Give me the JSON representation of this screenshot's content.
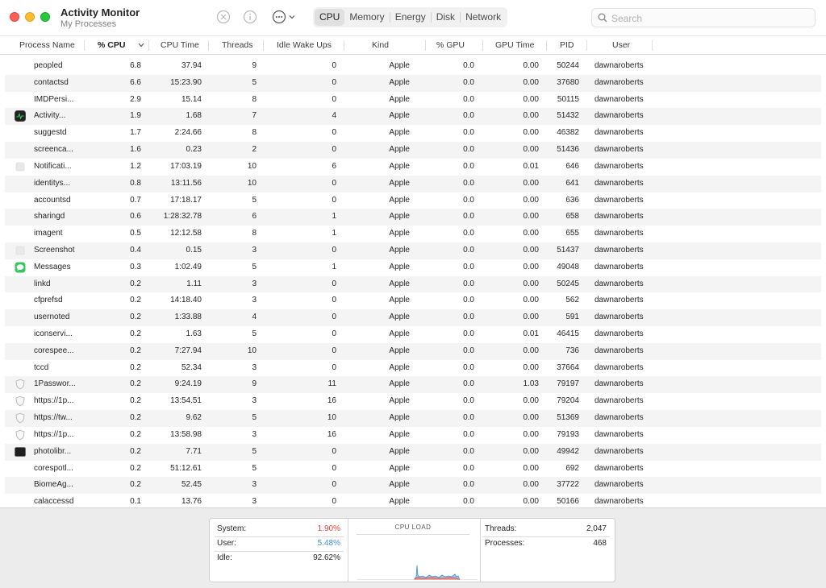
{
  "window": {
    "title": "Activity Monitor",
    "subtitle": "My Processes"
  },
  "toolbar": {
    "tabs": [
      {
        "label": "CPU",
        "active": true
      },
      {
        "label": "Memory",
        "active": false
      },
      {
        "label": "Energy",
        "active": false
      },
      {
        "label": "Disk",
        "active": false
      },
      {
        "label": "Network",
        "active": false
      }
    ],
    "buttons": {
      "stop": "stop-process-icon",
      "info": "info-icon",
      "more": "ellipsis-menu-icon"
    }
  },
  "search": {
    "placeholder": "Search",
    "value": ""
  },
  "table": {
    "columns": [
      "Process Name",
      "% CPU",
      "CPU Time",
      "Threads",
      "Idle Wake Ups",
      "Kind",
      "% GPU",
      "GPU Time",
      "PID",
      "User"
    ],
    "sorted_column": "% CPU",
    "rows": [
      {
        "name": "peopled",
        "cpu": "6.8",
        "cpu_time": "37.94",
        "threads": "9",
        "idle": "0",
        "kind": "Apple",
        "gpu": "0.0",
        "gpu_time": "0.00",
        "pid": "50244",
        "user": "dawnaroberts",
        "icon": ""
      },
      {
        "name": "contactsd",
        "cpu": "6.6",
        "cpu_time": "15:23.90",
        "threads": "5",
        "idle": "0",
        "kind": "Apple",
        "gpu": "0.0",
        "gpu_time": "0.00",
        "pid": "37680",
        "user": "dawnaroberts",
        "icon": ""
      },
      {
        "name": "IMDPersi...",
        "cpu": "2.9",
        "cpu_time": "15.14",
        "threads": "8",
        "idle": "0",
        "kind": "Apple",
        "gpu": "0.0",
        "gpu_time": "0.00",
        "pid": "50115",
        "user": "dawnaroberts",
        "icon": ""
      },
      {
        "name": "Activity...",
        "cpu": "1.9",
        "cpu_time": "1.68",
        "threads": "7",
        "idle": "4",
        "kind": "Apple",
        "gpu": "0.0",
        "gpu_time": "0.00",
        "pid": "51432",
        "user": "dawnaroberts",
        "icon": "activity-monitor"
      },
      {
        "name": "suggestd",
        "cpu": "1.7",
        "cpu_time": "2:24.66",
        "threads": "8",
        "idle": "0",
        "kind": "Apple",
        "gpu": "0.0",
        "gpu_time": "0.00",
        "pid": "46382",
        "user": "dawnaroberts",
        "icon": ""
      },
      {
        "name": "screenca...",
        "cpu": "1.6",
        "cpu_time": "0.23",
        "threads": "2",
        "idle": "0",
        "kind": "Apple",
        "gpu": "0.0",
        "gpu_time": "0.00",
        "pid": "51436",
        "user": "dawnaroberts",
        "icon": ""
      },
      {
        "name": "Notificati...",
        "cpu": "1.2",
        "cpu_time": "17:03.19",
        "threads": "10",
        "idle": "6",
        "kind": "Apple",
        "gpu": "0.0",
        "gpu_time": "0.01",
        "pid": "646",
        "user": "dawnaroberts",
        "icon": "blank"
      },
      {
        "name": "identitys...",
        "cpu": "0.8",
        "cpu_time": "13:11.56",
        "threads": "10",
        "idle": "0",
        "kind": "Apple",
        "gpu": "0.0",
        "gpu_time": "0.00",
        "pid": "641",
        "user": "dawnaroberts",
        "icon": ""
      },
      {
        "name": "accountsd",
        "cpu": "0.7",
        "cpu_time": "17:18.17",
        "threads": "5",
        "idle": "0",
        "kind": "Apple",
        "gpu": "0.0",
        "gpu_time": "0.00",
        "pid": "636",
        "user": "dawnaroberts",
        "icon": ""
      },
      {
        "name": "sharingd",
        "cpu": "0.6",
        "cpu_time": "1:28:32.78",
        "threads": "6",
        "idle": "1",
        "kind": "Apple",
        "gpu": "0.0",
        "gpu_time": "0.00",
        "pid": "658",
        "user": "dawnaroberts",
        "icon": ""
      },
      {
        "name": "imagent",
        "cpu": "0.5",
        "cpu_time": "12:12.58",
        "threads": "8",
        "idle": "1",
        "kind": "Apple",
        "gpu": "0.0",
        "gpu_time": "0.00",
        "pid": "655",
        "user": "dawnaroberts",
        "icon": ""
      },
      {
        "name": "Screenshot",
        "cpu": "0.4",
        "cpu_time": "0.15",
        "threads": "3",
        "idle": "0",
        "kind": "Apple",
        "gpu": "0.0",
        "gpu_time": "0.00",
        "pid": "51437",
        "user": "dawnaroberts",
        "icon": "blank"
      },
      {
        "name": "Messages",
        "cpu": "0.3",
        "cpu_time": "1:02.49",
        "threads": "5",
        "idle": "1",
        "kind": "Apple",
        "gpu": "0.0",
        "gpu_time": "0.00",
        "pid": "49048",
        "user": "dawnaroberts",
        "icon": "messages"
      },
      {
        "name": "linkd",
        "cpu": "0.2",
        "cpu_time": "1.11",
        "threads": "3",
        "idle": "0",
        "kind": "Apple",
        "gpu": "0.0",
        "gpu_time": "0.00",
        "pid": "50245",
        "user": "dawnaroberts",
        "icon": ""
      },
      {
        "name": "cfprefsd",
        "cpu": "0.2",
        "cpu_time": "14:18.40",
        "threads": "3",
        "idle": "0",
        "kind": "Apple",
        "gpu": "0.0",
        "gpu_time": "0.00",
        "pid": "562",
        "user": "dawnaroberts",
        "icon": ""
      },
      {
        "name": "usernoted",
        "cpu": "0.2",
        "cpu_time": "1:33.88",
        "threads": "4",
        "idle": "0",
        "kind": "Apple",
        "gpu": "0.0",
        "gpu_time": "0.00",
        "pid": "591",
        "user": "dawnaroberts",
        "icon": ""
      },
      {
        "name": "iconservi...",
        "cpu": "0.2",
        "cpu_time": "1.63",
        "threads": "5",
        "idle": "0",
        "kind": "Apple",
        "gpu": "0.0",
        "gpu_time": "0.01",
        "pid": "46415",
        "user": "dawnaroberts",
        "icon": ""
      },
      {
        "name": "corespee...",
        "cpu": "0.2",
        "cpu_time": "7:27.94",
        "threads": "10",
        "idle": "0",
        "kind": "Apple",
        "gpu": "0.0",
        "gpu_time": "0.00",
        "pid": "736",
        "user": "dawnaroberts",
        "icon": ""
      },
      {
        "name": "tccd",
        "cpu": "0.2",
        "cpu_time": "52.34",
        "threads": "3",
        "idle": "0",
        "kind": "Apple",
        "gpu": "0.0",
        "gpu_time": "0.00",
        "pid": "37664",
        "user": "dawnaroberts",
        "icon": ""
      },
      {
        "name": "1Passwor...",
        "cpu": "0.2",
        "cpu_time": "9:24.19",
        "threads": "9",
        "idle": "11",
        "kind": "Apple",
        "gpu": "0.0",
        "gpu_time": "1.03",
        "pid": "79197",
        "user": "dawnaroberts",
        "icon": "shield"
      },
      {
        "name": "https://1p...",
        "cpu": "0.2",
        "cpu_time": "13:54.51",
        "threads": "3",
        "idle": "16",
        "kind": "Apple",
        "gpu": "0.0",
        "gpu_time": "0.00",
        "pid": "79204",
        "user": "dawnaroberts",
        "icon": "shield"
      },
      {
        "name": "https://tw...",
        "cpu": "0.2",
        "cpu_time": "9.62",
        "threads": "5",
        "idle": "10",
        "kind": "Apple",
        "gpu": "0.0",
        "gpu_time": "0.00",
        "pid": "51369",
        "user": "dawnaroberts",
        "icon": "shield"
      },
      {
        "name": "https://1p...",
        "cpu": "0.2",
        "cpu_time": "13:58.98",
        "threads": "3",
        "idle": "16",
        "kind": "Apple",
        "gpu": "0.0",
        "gpu_time": "0.00",
        "pid": "79193",
        "user": "dawnaroberts",
        "icon": "shield"
      },
      {
        "name": "photolibr...",
        "cpu": "0.2",
        "cpu_time": "7.71",
        "threads": "5",
        "idle": "0",
        "kind": "Apple",
        "gpu": "0.0",
        "gpu_time": "0.00",
        "pid": "49942",
        "user": "dawnaroberts",
        "icon": "terminal"
      },
      {
        "name": "corespotl...",
        "cpu": "0.2",
        "cpu_time": "51:12.61",
        "threads": "5",
        "idle": "0",
        "kind": "Apple",
        "gpu": "0.0",
        "gpu_time": "0.00",
        "pid": "692",
        "user": "dawnaroberts",
        "icon": ""
      },
      {
        "name": "BiomeAg...",
        "cpu": "0.2",
        "cpu_time": "52.45",
        "threads": "3",
        "idle": "0",
        "kind": "Apple",
        "gpu": "0.0",
        "gpu_time": "0.00",
        "pid": "37722",
        "user": "dawnaroberts",
        "icon": ""
      },
      {
        "name": "calaccessd",
        "cpu": "0.1",
        "cpu_time": "13.76",
        "threads": "3",
        "idle": "0",
        "kind": "Apple",
        "gpu": "0.0",
        "gpu_time": "0.00",
        "pid": "50166",
        "user": "dawnaroberts",
        "icon": ""
      }
    ]
  },
  "footer": {
    "system_label": "System:",
    "system_value": "1.90%",
    "user_label": "User:",
    "user_value": "5.48%",
    "idle_label": "Idle:",
    "idle_value": "92.62%",
    "cpu_load_title": "CPU LOAD",
    "threads_label": "Threads:",
    "threads_value": "2,047",
    "processes_label": "Processes:",
    "processes_value": "468"
  },
  "colors": {
    "system": "#e0403a",
    "user": "#3f8fd8",
    "stripe": "#f4f4f5",
    "accent_selected_tab": "#e0e0e0"
  }
}
